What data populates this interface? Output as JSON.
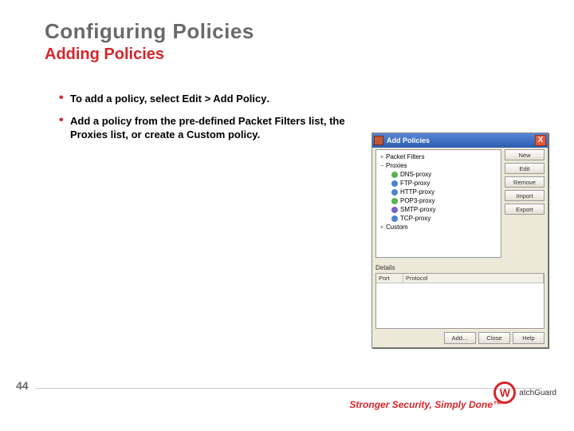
{
  "slide": {
    "title": "Configuring Policies",
    "subtitle": "Adding Policies",
    "page_number": "44"
  },
  "bullets": [
    {
      "pre": "To add a policy, select ",
      "strong": "Edit > Add Policy",
      "post": "."
    },
    {
      "pre": "Add a policy from the pre-defined Packet Filters list, the Proxies list, or create a Custom policy.",
      "strong": "",
      "post": ""
    }
  ],
  "dialog": {
    "title": "Add Policies",
    "close": "X",
    "tree": {
      "packet_filters": "Packet Filters",
      "proxies": "Proxies",
      "items": [
        {
          "label": "DNS-proxy",
          "icon": "ic-green"
        },
        {
          "label": "FTP-proxy",
          "icon": "ic-blue"
        },
        {
          "label": "HTTP-proxy",
          "icon": "ic-blue"
        },
        {
          "label": "POP3-proxy",
          "icon": "ic-green"
        },
        {
          "label": "SMTP-proxy",
          "icon": "ic-purple"
        },
        {
          "label": "TCP-proxy",
          "icon": "ic-blue"
        }
      ],
      "custom": "Custom"
    },
    "side_buttons": {
      "new": "New",
      "edit": "Edit",
      "remove": "Remove",
      "import": "Import",
      "export": "Export"
    },
    "details_label": "Details",
    "details_cols": {
      "port": "Port",
      "protocol": "Protocol"
    },
    "bottom_buttons": {
      "add": "Add…",
      "close": "Close",
      "help": "Help"
    }
  },
  "footer": {
    "tagline": "Stronger Security, Simply Done™",
    "logo_text": "atchGuard",
    "logo_mark": "W"
  }
}
